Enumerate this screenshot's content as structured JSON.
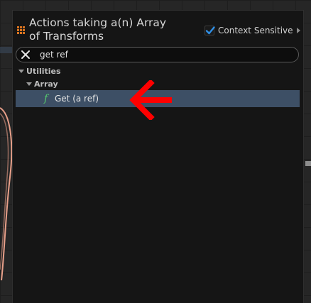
{
  "header": {
    "title": "Actions taking a(n) Array of Transforms",
    "context_sensitive_label": "Context Sensitive",
    "context_sensitive_checked": true
  },
  "search": {
    "value": "get ref",
    "placeholder": ""
  },
  "tree": {
    "categories": [
      {
        "label": "Utilities",
        "expanded": true,
        "children": [
          {
            "label": "Array",
            "expanded": true,
            "items": [
              {
                "label": "Get (a ref)",
                "icon": "function-icon",
                "icon_glyph": "f",
                "selected": true
              }
            ]
          }
        ]
      }
    ]
  },
  "colors": {
    "background": "#262626",
    "panel": "#151515",
    "selection": "#3d4f65",
    "function_icon": "#56c96e",
    "arrow": "#ff0000",
    "wire": "#e8a08a",
    "checkbox_accent": "#2f8fe6",
    "header_icon": "#d9731f"
  },
  "annotation": {
    "icon": "red-arrow-left-icon"
  }
}
